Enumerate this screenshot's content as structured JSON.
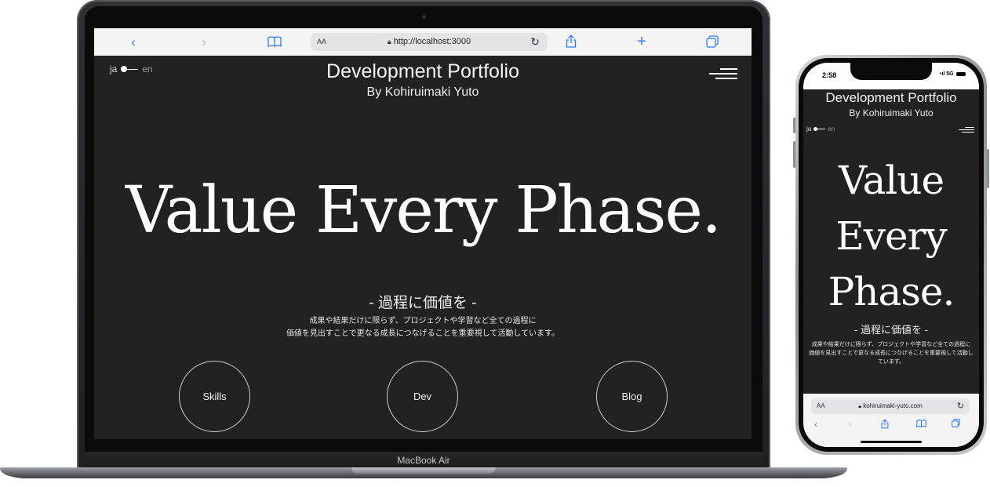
{
  "laptop": {
    "model_label": "MacBook Air",
    "toolbar": {
      "back_icon": "‹",
      "forward_icon": "›",
      "bookmarks_icon": "📖",
      "text_size_label": "AA",
      "lock_icon": "🔒",
      "url": "http://localhost:3000",
      "reload_icon": "↻",
      "share_icon": "⇪",
      "new_tab_icon": "+",
      "tabs_icon": "⧉"
    }
  },
  "site": {
    "lang_ja": "ja",
    "lang_en": "en",
    "title": "Development Portfolio",
    "subtitle": "By Kohiruimaki Yuto",
    "hero": "Value Every Phase.",
    "hero_lines": [
      "Value",
      "Every",
      "Phase."
    ],
    "tagline": "- 過程に価値を -",
    "description_line1": "成果や結果だけに限らず、プロジェクトや学習など全ての過程に",
    "description_line2": "価値を見出すことで更なる成長につなげることを重要視して活動しています。",
    "mobile_description_line1": "成果や結果だけに限らず、プロジェクトや学習など全ての過程に",
    "mobile_description_line2": "価値を見出すことで更なる成長につなげることを重要視して活動しています。",
    "nav_buttons": [
      "Skills",
      "Dev",
      "Blog"
    ]
  },
  "phone": {
    "time": "2:58",
    "signal": "•ıl 5G",
    "text_size_label": "AA",
    "lock_icon": "🔒",
    "url": "kohiruimaki-yuto.com",
    "reload_icon": "↻",
    "back_icon": "‹",
    "forward_icon": "›",
    "share_icon": "⇪",
    "bookmarks_icon": "📖",
    "tabs_icon": "⧉"
  },
  "colors": {
    "page_bg": "#222222",
    "toolbar_accent": "#2e7cf6",
    "text": "#f2f2f2"
  }
}
